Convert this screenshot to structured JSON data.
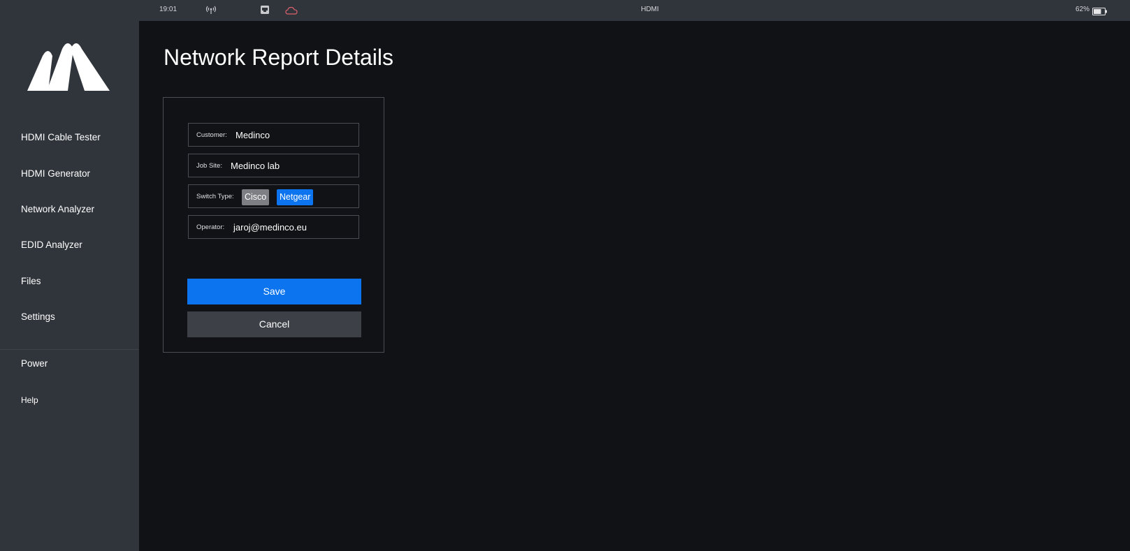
{
  "status_bar": {
    "time": "19:01",
    "source": "HDMI",
    "battery_pct": "62%",
    "icons": [
      "wifi-icon",
      "network-icon",
      "cloud-icon",
      "battery-icon"
    ],
    "cloud_color": "#e0626c"
  },
  "sidebar": {
    "logo": "brand-logo",
    "items": [
      {
        "label": "HDMI Cable Tester"
      },
      {
        "label": "HDMI Generator"
      },
      {
        "label": "Network Analyzer"
      },
      {
        "label": "EDID Analyzer"
      },
      {
        "label": "Files"
      },
      {
        "label": "Settings"
      }
    ],
    "bottom_items": [
      {
        "label": "Power"
      },
      {
        "label": "Help"
      }
    ]
  },
  "main": {
    "title": "Network Report Details",
    "form": {
      "customer": {
        "label": "Customer:",
        "value": "Medinco"
      },
      "job_site": {
        "label": "Job Site:",
        "value": "Medinco lab"
      },
      "switch_type": {
        "label": "Switch Type:",
        "options": [
          "Cisco",
          "Netgear"
        ],
        "selected": "Netgear"
      },
      "operator": {
        "label": "Operator:",
        "value": "jaroj@medinco.eu"
      },
      "save_label": "Save",
      "cancel_label": "Cancel"
    }
  },
  "colors": {
    "accent": "#0b74ee",
    "sidebar_bg": "#30343b",
    "main_bg": "#111215",
    "unselected_option": "#7d7f84",
    "cancel_bg": "#3d4047"
  }
}
